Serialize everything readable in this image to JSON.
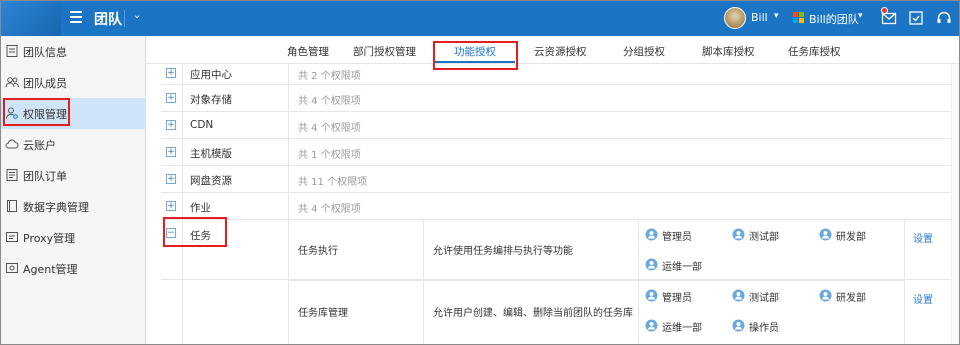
{
  "topbar": {
    "app_title": "团队",
    "user_name": "Bill",
    "team_name": "Bill的团队"
  },
  "sidebar": {
    "items": [
      {
        "label": "团队信息",
        "icon": "doc-icon"
      },
      {
        "label": "团队成员",
        "icon": "users-icon"
      },
      {
        "label": "权限管理",
        "icon": "user-settings-icon",
        "active": true
      },
      {
        "label": "云账户",
        "icon": "cloud-icon"
      },
      {
        "label": "团队订单",
        "icon": "order-icon"
      },
      {
        "label": "数据字典管理",
        "icon": "book-icon"
      },
      {
        "label": "Proxy管理",
        "icon": "proxy-icon"
      },
      {
        "label": "Agent管理",
        "icon": "agent-icon"
      }
    ]
  },
  "tabs": [
    {
      "label": "角色管理"
    },
    {
      "label": "部门授权管理"
    },
    {
      "label": "功能授权",
      "active": true
    },
    {
      "label": "云资源授权"
    },
    {
      "label": "分组授权"
    },
    {
      "label": "脚本库授权"
    },
    {
      "label": "任务库授权"
    }
  ],
  "groups": [
    {
      "name": "应用中心",
      "count": "共 2 个权限项",
      "expanded": false
    },
    {
      "name": "对象存储",
      "count": "共 4 个权限项",
      "expanded": false
    },
    {
      "name": "CDN",
      "count": "共 4 个权限项",
      "expanded": false
    },
    {
      "name": "主机模版",
      "count": "共 1 个权限项",
      "expanded": false
    },
    {
      "name": "网盘资源",
      "count": "共 11 个权限项",
      "expanded": false
    },
    {
      "name": "作业",
      "count": "共 4 个权限项",
      "expanded": false
    },
    {
      "name": "任务",
      "count": "",
      "expanded": true
    }
  ],
  "task_items": [
    {
      "name": "任务执行",
      "desc": "允许使用任务编排与执行等功能",
      "roles": [
        "管理员",
        "测试部",
        "研发部",
        "运维一部"
      ],
      "action": "设置"
    },
    {
      "name": "任务库管理",
      "desc": "允许用户创建、编辑、删除当前团队的任务库",
      "roles": [
        "管理员",
        "测试部",
        "研发部",
        "运维一部",
        "操作员"
      ],
      "action": "设置"
    }
  ],
  "colors": {
    "topbar": "#1c74c4",
    "accent": "#1c74c4",
    "highlight_box": "#e02020",
    "link": "#2a7bd0"
  }
}
